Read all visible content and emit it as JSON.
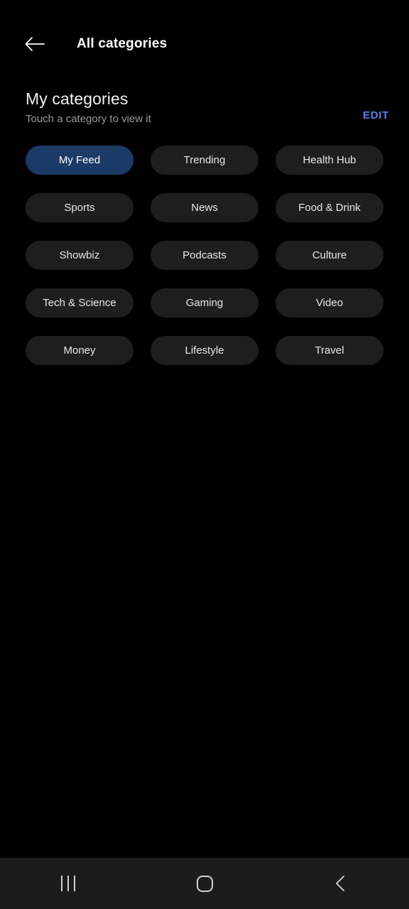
{
  "appbar": {
    "back_icon": "arrow-left-icon",
    "title": "All categories"
  },
  "section": {
    "title": "My categories",
    "subtitle": "Touch a category to view it",
    "edit_label": "EDIT"
  },
  "colors": {
    "page_background": "#000000",
    "chip_background": "#1e1e1e",
    "chip_selected_background": "#1c3a66",
    "accent_link": "#5a7fe8",
    "navbar_background": "#1c1c1c",
    "primary_text": "#ffffff",
    "secondary_text": "#9a9a9a"
  },
  "categories": [
    {
      "label": "My Feed",
      "selected": true
    },
    {
      "label": "Trending",
      "selected": false
    },
    {
      "label": "Health Hub",
      "selected": false
    },
    {
      "label": "Sports",
      "selected": false
    },
    {
      "label": "News",
      "selected": false
    },
    {
      "label": "Food & Drink",
      "selected": false
    },
    {
      "label": "Showbiz",
      "selected": false
    },
    {
      "label": "Podcasts",
      "selected": false
    },
    {
      "label": "Culture",
      "selected": false
    },
    {
      "label": "Tech & Science",
      "selected": false
    },
    {
      "label": "Gaming",
      "selected": false
    },
    {
      "label": "Video",
      "selected": false
    },
    {
      "label": "Money",
      "selected": false
    },
    {
      "label": "Lifestyle",
      "selected": false
    },
    {
      "label": "Travel",
      "selected": false
    }
  ],
  "navbar": {
    "recents_icon": "recents-icon",
    "home_icon": "home-icon",
    "back_icon": "chevron-left-icon"
  }
}
